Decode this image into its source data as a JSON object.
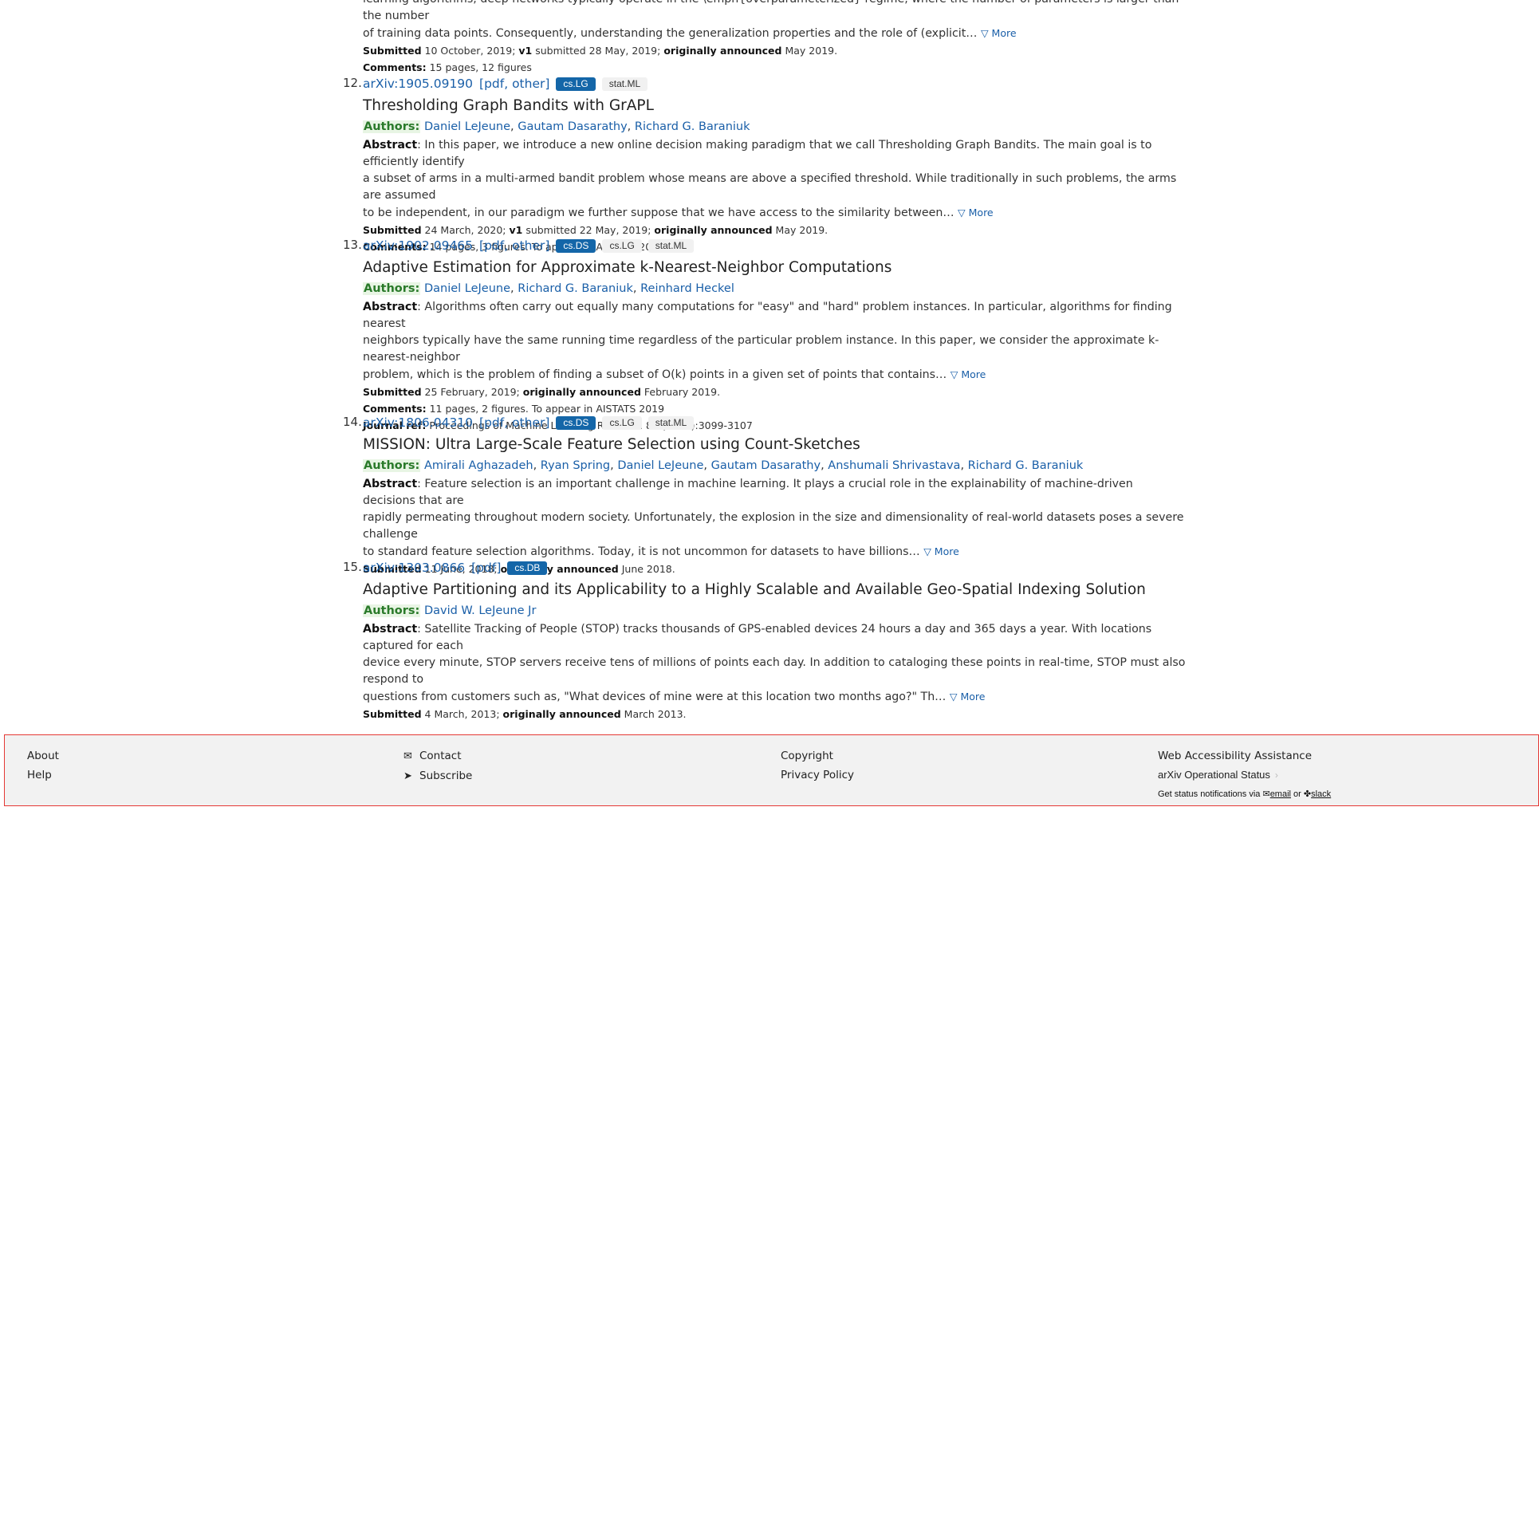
{
  "truncated_item": {
    "abstract_tail_1": "learning algorithms, deep networks typically operate in the \\emph{overparameterized} regime, where the number of parameters is larger than the number",
    "abstract_tail_2": "of training data points. Consequently, understanding the generalization properties and the role of (explicit…",
    "more": "▽ More",
    "submitted_label": "Submitted",
    "submitted": "10 October, 2019;",
    "v1_label": "v1",
    "v1_text": "submitted 28 May, 2019;",
    "announced_label": "originally announced",
    "announced": "May 2019.",
    "comments_label": "Comments:",
    "comments": "15 pages, 12 figures"
  },
  "results": [
    {
      "number": "12.",
      "id": "arXiv:1905.09190",
      "formats": "[pdf, other]",
      "primary_tag": "cs.LG",
      "tags": [
        "stat.ML"
      ],
      "title": "Thresholding Graph Bandits with GrAPL",
      "authors_label": "Authors:",
      "authors": [
        "Daniel LeJeune",
        "Gautam Dasarathy",
        "Richard G. Baraniuk"
      ],
      "abstract_label": "Abstract",
      "abstract_lines": [
        ": In this paper, we introduce a new online decision making paradigm that we call Thresholding Graph Bandits. The main goal is to efficiently identify",
        "a subset of arms in a multi-armed bandit problem whose means are above a specified threshold. While traditionally in such problems, the arms are assumed",
        "to be independent, in our paradigm we further suppose that we have access to the similarity between…"
      ],
      "more": "▽ More",
      "submitted": "24 March, 2020;",
      "v1": "submitted 22 May, 2019;",
      "announced": "May 2019.",
      "comments": "14 pages, 3 figures. To appear in AISTATS 2020",
      "journal": ""
    },
    {
      "number": "13.",
      "id": "arXiv:1902.09465",
      "formats": "[pdf, other]",
      "primary_tag": "cs.DS",
      "tags": [
        "cs.LG",
        "stat.ML"
      ],
      "title": "Adaptive Estimation for Approximate k-Nearest-Neighbor Computations",
      "authors_label": "Authors:",
      "authors": [
        "Daniel LeJeune",
        "Richard G. Baraniuk",
        "Reinhard Heckel"
      ],
      "abstract_label": "Abstract",
      "abstract_lines": [
        ": Algorithms often carry out equally many computations for \"easy\" and \"hard\" problem instances. In particular, algorithms for finding nearest",
        "neighbors typically have the same running time regardless of the particular problem instance. In this paper, we consider the approximate k-nearest-neighbor",
        "problem, which is the problem of finding a subset of O(k) points in a given set of points that contains…"
      ],
      "more": "▽ More",
      "submitted": "25 February, 2019;",
      "v1": "",
      "announced": "February 2019.",
      "comments": "11 pages, 2 figures. To appear in AISTATS 2019",
      "journal": "Proceedings of Machine Learning Research 89 (2019):3099-3107"
    },
    {
      "number": "14.",
      "id": "arXiv:1806.04310",
      "formats": "[pdf, other]",
      "primary_tag": "cs.DS",
      "tags": [
        "cs.LG",
        "stat.ML"
      ],
      "title": "MISSION: Ultra Large-Scale Feature Selection using Count-Sketches",
      "authors_label": "Authors:",
      "authors": [
        "Amirali Aghazadeh",
        "Ryan Spring",
        "Daniel LeJeune",
        "Gautam Dasarathy",
        "Anshumali Shrivastava",
        "Richard G. Baraniuk"
      ],
      "abstract_label": "Abstract",
      "abstract_lines": [
        ": Feature selection is an important challenge in machine learning. It plays a crucial role in the explainability of machine-driven decisions that are",
        "rapidly permeating throughout modern society. Unfortunately, the explosion in the size and dimensionality of real-world datasets poses a severe challenge",
        "to standard feature selection algorithms. Today, it is not uncommon for datasets to have billions…"
      ],
      "more": "▽ More",
      "submitted": "11 June, 2018;",
      "v1": "",
      "announced": "June 2018.",
      "comments": "",
      "journal": ""
    },
    {
      "number": "15.",
      "id": "arXiv:1303.0866",
      "formats": "[pdf]",
      "primary_tag": "cs.DB",
      "tags": [],
      "title": "Adaptive Partitioning and its Applicability to a Highly Scalable and Available Geo-Spatial Indexing Solution",
      "authors_label": "Authors:",
      "authors": [
        "David W. LeJeune Jr"
      ],
      "abstract_label": "Abstract",
      "abstract_lines": [
        ": Satellite Tracking of People (STOP) tracks thousands of GPS-enabled devices 24 hours a day and 365 days a year. With locations captured for each",
        "device every minute, STOP servers receive tens of millions of points each day. In addition to cataloging these points in real-time, STOP must also respond to",
        "questions from customers such as, \"What devices of mine were at this location two months ago?\" Th…"
      ],
      "more": "▽ More",
      "submitted": "4 March, 2013;",
      "v1": "",
      "announced": "March 2013.",
      "comments": "",
      "journal": ""
    }
  ],
  "labels": {
    "submitted": "Submitted",
    "v1": "v1",
    "announced": "originally announced",
    "comments": "Comments:",
    "journal": "Journal ref:"
  },
  "footer": {
    "about": "About",
    "help": "Help",
    "contact": "Contact",
    "subscribe": "Subscribe",
    "copyright": "Copyright",
    "privacy": "Privacy Policy",
    "accessibility": "Web Accessibility Assistance",
    "status": "arXiv Operational Status",
    "notify_prefix": "Get status notifications via",
    "email": "email",
    "or": "or",
    "slack": "slack",
    "border_color": "#e53935"
  }
}
